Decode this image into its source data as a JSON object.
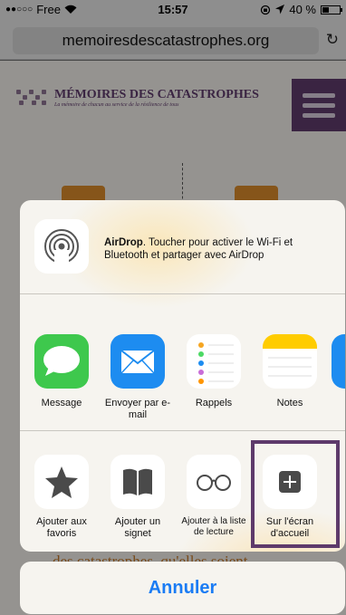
{
  "status": {
    "signal": "●●○○○",
    "carrier": "Free",
    "time": "15:57",
    "battery_text": "40 %",
    "battery_level": 0.4
  },
  "browser": {
    "url": "memoiresdescatastrophes.org",
    "reload_icon": "reload-icon"
  },
  "site": {
    "title": "MÉMOIRES DES CATASTROPHES",
    "tagline": "La mémoire de chacun au service de la résilience de tous",
    "partial_text": "des catastrophes, qu'elles soient"
  },
  "airdrop": {
    "label_bold": "AirDrop",
    "label_rest": ". Toucher pour activer le Wi-Fi et Bluetooth et partager avec AirDrop"
  },
  "apps": [
    {
      "label": "Message",
      "icon": "message-icon",
      "color": "#3ec84d"
    },
    {
      "label": "Envoyer par e-mail",
      "icon": "mail-icon",
      "color": "#1d8cf0"
    },
    {
      "label": "Rappels",
      "icon": "reminders-icon",
      "color": "#ffffff"
    },
    {
      "label": "Notes",
      "icon": "notes-icon",
      "color": "#ffffff"
    }
  ],
  "actions": [
    {
      "label": "Ajouter aux favoris",
      "icon": "star-icon"
    },
    {
      "label": "Ajouter un signet",
      "icon": "book-icon"
    },
    {
      "label": "Ajouter à la liste de lecture",
      "icon": "glasses-icon"
    },
    {
      "label": "Sur l'écran d'accueil",
      "icon": "add-home-icon"
    }
  ],
  "cancel_label": "Annuler",
  "colors": {
    "accent": "#1a7cf4",
    "brand_purple": "#5e3a6b",
    "highlight": "#5e3a6b"
  }
}
